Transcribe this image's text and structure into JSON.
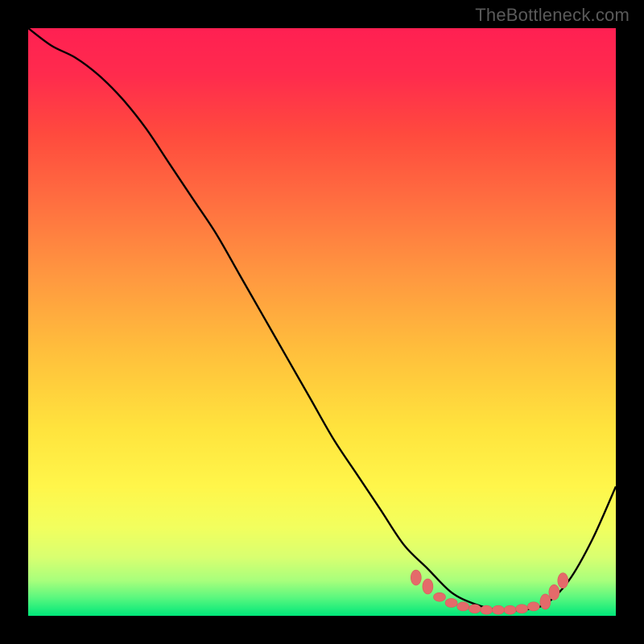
{
  "watermark": "TheBottleneck.com",
  "colors": {
    "background": "#000000",
    "gradient_stops": [
      {
        "offset": 0.0,
        "color": "#ff2052"
      },
      {
        "offset": 0.08,
        "color": "#ff2b4d"
      },
      {
        "offset": 0.18,
        "color": "#ff4a3e"
      },
      {
        "offset": 0.3,
        "color": "#ff7040"
      },
      {
        "offset": 0.42,
        "color": "#ff9740"
      },
      {
        "offset": 0.55,
        "color": "#ffbf3c"
      },
      {
        "offset": 0.68,
        "color": "#ffe33d"
      },
      {
        "offset": 0.78,
        "color": "#fff64a"
      },
      {
        "offset": 0.85,
        "color": "#f2ff5e"
      },
      {
        "offset": 0.9,
        "color": "#d9ff70"
      },
      {
        "offset": 0.94,
        "color": "#a8ff7c"
      },
      {
        "offset": 0.97,
        "color": "#58f77e"
      },
      {
        "offset": 1.0,
        "color": "#00e77a"
      }
    ],
    "curve": "#000000",
    "marker_fill": "#e46a6a",
    "marker_stroke": "#d85a5a"
  },
  "chart_data": {
    "type": "line",
    "title": "",
    "xlabel": "",
    "ylabel": "",
    "xlim": [
      0,
      100
    ],
    "ylim": [
      0,
      100
    ],
    "series": [
      {
        "name": "bottleneck-curve",
        "x": [
          0,
          4,
          8,
          12,
          16,
          20,
          24,
          28,
          32,
          36,
          40,
          44,
          48,
          52,
          56,
          60,
          64,
          68,
          72,
          76,
          80,
          84,
          88,
          92,
          96,
          100
        ],
        "y": [
          100,
          97,
          95,
          92,
          88,
          83,
          77,
          71,
          65,
          58,
          51,
          44,
          37,
          30,
          24,
          18,
          12,
          8,
          4,
          2,
          1,
          1,
          2,
          6,
          13,
          22
        ]
      }
    ],
    "markers": {
      "name": "optimal-zone",
      "points": [
        {
          "x": 66,
          "y": 6.5
        },
        {
          "x": 68,
          "y": 5.0
        },
        {
          "x": 70,
          "y": 3.2
        },
        {
          "x": 72,
          "y": 2.2
        },
        {
          "x": 74,
          "y": 1.6
        },
        {
          "x": 76,
          "y": 1.2
        },
        {
          "x": 78,
          "y": 1.0
        },
        {
          "x": 80,
          "y": 1.0
        },
        {
          "x": 82,
          "y": 1.0
        },
        {
          "x": 84,
          "y": 1.2
        },
        {
          "x": 86,
          "y": 1.6
        },
        {
          "x": 88,
          "y": 2.4
        },
        {
          "x": 89.5,
          "y": 4.0
        },
        {
          "x": 91,
          "y": 6.0
        }
      ]
    }
  }
}
